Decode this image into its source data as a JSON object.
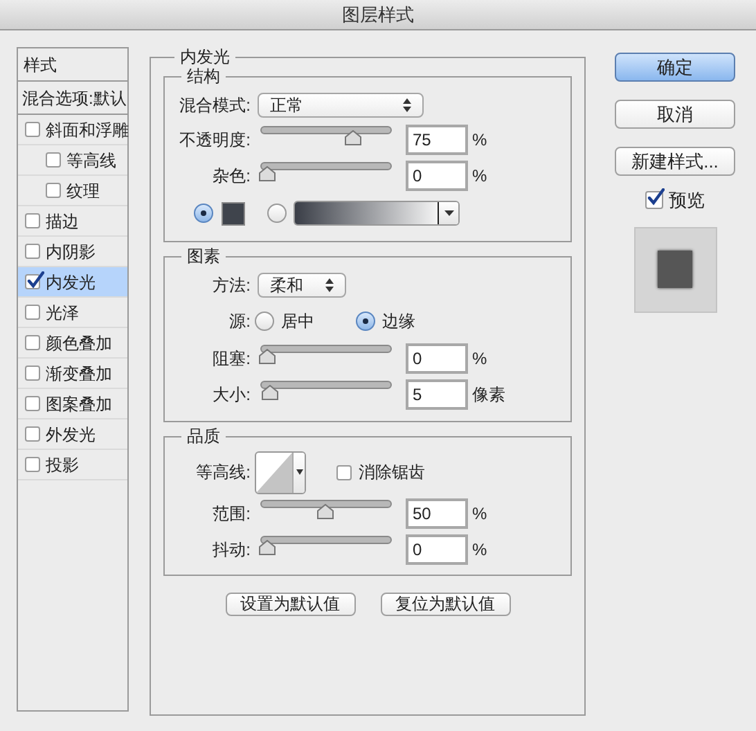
{
  "window": {
    "title": "图层样式"
  },
  "styles_list": {
    "header": "样式",
    "blending_options": "混合选项:默认",
    "items": [
      {
        "label": "斜面和浮雕",
        "checked": false,
        "selected": false,
        "children": [
          {
            "label": "等高线",
            "checked": false,
            "selected": false
          },
          {
            "label": "纹理",
            "checked": false,
            "selected": false
          }
        ]
      },
      {
        "label": "描边",
        "checked": false,
        "selected": false
      },
      {
        "label": "内阴影",
        "checked": false,
        "selected": false
      },
      {
        "label": "内发光",
        "checked": true,
        "selected": true
      },
      {
        "label": "光泽",
        "checked": false,
        "selected": false
      },
      {
        "label": "颜色叠加",
        "checked": false,
        "selected": false
      },
      {
        "label": "渐变叠加",
        "checked": false,
        "selected": false
      },
      {
        "label": "图案叠加",
        "checked": false,
        "selected": false
      },
      {
        "label": "外发光",
        "checked": false,
        "selected": false
      },
      {
        "label": "投影",
        "checked": false,
        "selected": false
      }
    ]
  },
  "panel": {
    "title": "内发光",
    "groups": [
      {
        "title": "结构",
        "rows": [
          {
            "kind": "select",
            "label": "混合模式:",
            "value": "正常"
          },
          {
            "kind": "slider",
            "label": "不透明度:",
            "level": 0.75,
            "value": "75",
            "unit": "%"
          },
          {
            "kind": "slider",
            "label": "杂色:",
            "level": 0,
            "value": "0",
            "unit": "%"
          },
          {
            "kind": "fill",
            "options": [
              {
                "kind": "color",
                "selected": true
              },
              {
                "kind": "gradient",
                "selected": false
              }
            ]
          }
        ]
      },
      {
        "title": "图素",
        "rows": [
          {
            "kind": "select",
            "label": "方法:",
            "value": "柔和"
          },
          {
            "kind": "radios",
            "label": "源:",
            "options": [
              {
                "label": "居中",
                "selected": false
              },
              {
                "label": "边缘",
                "selected": true
              }
            ]
          },
          {
            "kind": "slider",
            "label": "阻塞:",
            "level": 0,
            "value": "0",
            "unit": "%"
          },
          {
            "kind": "slider",
            "label": "大小:",
            "level": 0.02,
            "value": "5",
            "unit": "像素"
          }
        ]
      },
      {
        "title": "品质",
        "rows": [
          {
            "kind": "contour",
            "label": "等高线:",
            "checkbox": {
              "label": "消除锯齿",
              "checked": false
            }
          },
          {
            "kind": "slider",
            "label": "范围:",
            "level": 0.5,
            "value": "50",
            "unit": "%"
          },
          {
            "kind": "slider",
            "label": "抖动:",
            "level": 0,
            "value": "0",
            "unit": "%"
          }
        ]
      }
    ],
    "buttons": [
      "设置为默认值",
      "复位为默认值"
    ]
  },
  "side_buttons": [
    {
      "label": "确定",
      "default": true
    },
    {
      "label": "取消",
      "default": false
    },
    {
      "label": "新建样式...",
      "default": false
    }
  ],
  "preview": {
    "label": "预览",
    "checked": true
  }
}
